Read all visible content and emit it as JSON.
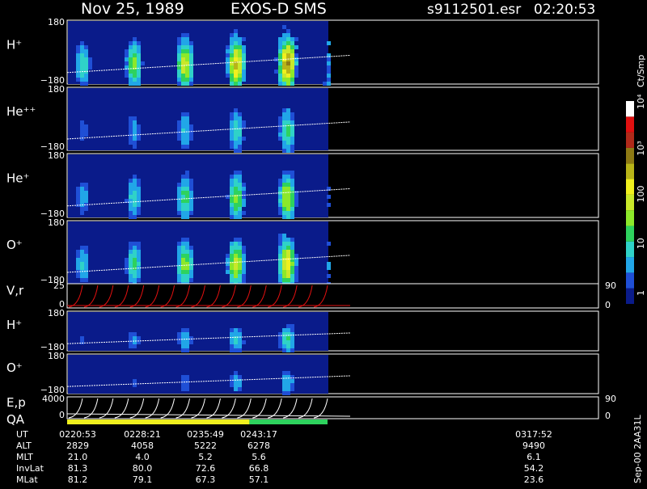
{
  "header": {
    "date": "Nov 25, 1989",
    "instrument": "EXOS-D SMS",
    "file": "s9112501.esr",
    "time": "02:20:53"
  },
  "chart_data": {
    "type": "heatmap",
    "colorbar": {
      "title": "Ct/Smp",
      "ticks": [
        "1",
        "10",
        "100",
        "10³",
        "10⁴"
      ],
      "colors": [
        "#0a1b8a",
        "#1f4fd6",
        "#21a6e8",
        "#2fd2c8",
        "#2ed25e",
        "#8ce82a",
        "#c9e82a",
        "#f0f01e",
        "#b8b418",
        "#8e7a14",
        "#b02a1a",
        "#e01010",
        "#ffffff"
      ]
    },
    "panels": [
      {
        "label": "H⁺",
        "ytop": "180",
        "ybottom": "−180",
        "peak": 0.85
      },
      {
        "label": "He⁺⁺",
        "ytop": "180",
        "ybottom": "−180",
        "peak": 0.38
      },
      {
        "label": "He⁺",
        "ytop": "180",
        "ybottom": "−180",
        "peak": 0.55
      },
      {
        "label": "O⁺",
        "ytop": "180",
        "ybottom": "−180",
        "peak": 0.68
      },
      {
        "label": "V,r",
        "ytop": "25",
        "ybottom": "0",
        "right_top": "90",
        "right_bottom": "0"
      },
      {
        "label": "H⁺",
        "ytop": "180",
        "ybottom": "−180",
        "peak": 0.35
      },
      {
        "label": "O⁺",
        "ytop": "180",
        "ybottom": "−180",
        "peak": 0.25
      },
      {
        "label": "E,p",
        "ytop": "4000",
        "ybottom": "0",
        "right_top": "90",
        "right_bottom": "0"
      }
    ],
    "qa_label": "QA",
    "qa_segments": [
      {
        "color": "#f0f01e",
        "from": 0,
        "to": 0.7
      },
      {
        "color": "#2ed25e",
        "from": 0.7,
        "to": 1.0
      }
    ],
    "data_extent": 0.49
  },
  "table": {
    "rows": [
      {
        "label": "UT",
        "values": [
          "0220:53",
          "0228:21",
          "0235:49",
          "0243:17",
          "0317:52"
        ]
      },
      {
        "label": "ALT",
        "values": [
          "2829",
          "4058",
          "5222",
          "6278",
          "9490"
        ]
      },
      {
        "label": "MLT",
        "values": [
          "21.0",
          "4.0",
          "5.2",
          "5.6",
          "6.1"
        ]
      },
      {
        "label": "InvLat",
        "values": [
          "81.3",
          "80.0",
          "72.6",
          "66.8",
          "54.2"
        ]
      },
      {
        "label": "MLat",
        "values": [
          "81.2",
          "79.1",
          "67.3",
          "57.1",
          "23.6"
        ]
      }
    ]
  },
  "footer": {
    "stamp": "Sep-00 2AA31L"
  }
}
